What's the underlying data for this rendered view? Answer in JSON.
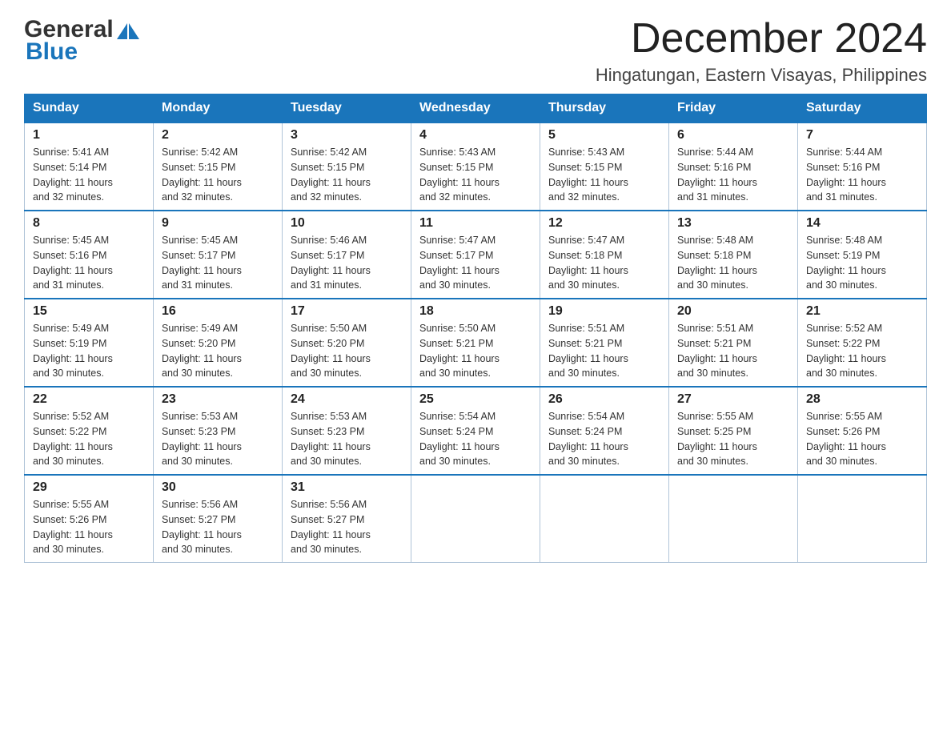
{
  "logo": {
    "general": "General",
    "blue": "Blue"
  },
  "title": "December 2024",
  "location": "Hingatungan, Eastern Visayas, Philippines",
  "days_of_week": [
    "Sunday",
    "Monday",
    "Tuesday",
    "Wednesday",
    "Thursday",
    "Friday",
    "Saturday"
  ],
  "weeks": [
    [
      {
        "day": "1",
        "sunrise": "5:41 AM",
        "sunset": "5:14 PM",
        "daylight": "11 hours and 32 minutes."
      },
      {
        "day": "2",
        "sunrise": "5:42 AM",
        "sunset": "5:15 PM",
        "daylight": "11 hours and 32 minutes."
      },
      {
        "day": "3",
        "sunrise": "5:42 AM",
        "sunset": "5:15 PM",
        "daylight": "11 hours and 32 minutes."
      },
      {
        "day": "4",
        "sunrise": "5:43 AM",
        "sunset": "5:15 PM",
        "daylight": "11 hours and 32 minutes."
      },
      {
        "day": "5",
        "sunrise": "5:43 AM",
        "sunset": "5:15 PM",
        "daylight": "11 hours and 32 minutes."
      },
      {
        "day": "6",
        "sunrise": "5:44 AM",
        "sunset": "5:16 PM",
        "daylight": "11 hours and 31 minutes."
      },
      {
        "day": "7",
        "sunrise": "5:44 AM",
        "sunset": "5:16 PM",
        "daylight": "11 hours and 31 minutes."
      }
    ],
    [
      {
        "day": "8",
        "sunrise": "5:45 AM",
        "sunset": "5:16 PM",
        "daylight": "11 hours and 31 minutes."
      },
      {
        "day": "9",
        "sunrise": "5:45 AM",
        "sunset": "5:17 PM",
        "daylight": "11 hours and 31 minutes."
      },
      {
        "day": "10",
        "sunrise": "5:46 AM",
        "sunset": "5:17 PM",
        "daylight": "11 hours and 31 minutes."
      },
      {
        "day": "11",
        "sunrise": "5:47 AM",
        "sunset": "5:17 PM",
        "daylight": "11 hours and 30 minutes."
      },
      {
        "day": "12",
        "sunrise": "5:47 AM",
        "sunset": "5:18 PM",
        "daylight": "11 hours and 30 minutes."
      },
      {
        "day": "13",
        "sunrise": "5:48 AM",
        "sunset": "5:18 PM",
        "daylight": "11 hours and 30 minutes."
      },
      {
        "day": "14",
        "sunrise": "5:48 AM",
        "sunset": "5:19 PM",
        "daylight": "11 hours and 30 minutes."
      }
    ],
    [
      {
        "day": "15",
        "sunrise": "5:49 AM",
        "sunset": "5:19 PM",
        "daylight": "11 hours and 30 minutes."
      },
      {
        "day": "16",
        "sunrise": "5:49 AM",
        "sunset": "5:20 PM",
        "daylight": "11 hours and 30 minutes."
      },
      {
        "day": "17",
        "sunrise": "5:50 AM",
        "sunset": "5:20 PM",
        "daylight": "11 hours and 30 minutes."
      },
      {
        "day": "18",
        "sunrise": "5:50 AM",
        "sunset": "5:21 PM",
        "daylight": "11 hours and 30 minutes."
      },
      {
        "day": "19",
        "sunrise": "5:51 AM",
        "sunset": "5:21 PM",
        "daylight": "11 hours and 30 minutes."
      },
      {
        "day": "20",
        "sunrise": "5:51 AM",
        "sunset": "5:21 PM",
        "daylight": "11 hours and 30 minutes."
      },
      {
        "day": "21",
        "sunrise": "5:52 AM",
        "sunset": "5:22 PM",
        "daylight": "11 hours and 30 minutes."
      }
    ],
    [
      {
        "day": "22",
        "sunrise": "5:52 AM",
        "sunset": "5:22 PM",
        "daylight": "11 hours and 30 minutes."
      },
      {
        "day": "23",
        "sunrise": "5:53 AM",
        "sunset": "5:23 PM",
        "daylight": "11 hours and 30 minutes."
      },
      {
        "day": "24",
        "sunrise": "5:53 AM",
        "sunset": "5:23 PM",
        "daylight": "11 hours and 30 minutes."
      },
      {
        "day": "25",
        "sunrise": "5:54 AM",
        "sunset": "5:24 PM",
        "daylight": "11 hours and 30 minutes."
      },
      {
        "day": "26",
        "sunrise": "5:54 AM",
        "sunset": "5:24 PM",
        "daylight": "11 hours and 30 minutes."
      },
      {
        "day": "27",
        "sunrise": "5:55 AM",
        "sunset": "5:25 PM",
        "daylight": "11 hours and 30 minutes."
      },
      {
        "day": "28",
        "sunrise": "5:55 AM",
        "sunset": "5:26 PM",
        "daylight": "11 hours and 30 minutes."
      }
    ],
    [
      {
        "day": "29",
        "sunrise": "5:55 AM",
        "sunset": "5:26 PM",
        "daylight": "11 hours and 30 minutes."
      },
      {
        "day": "30",
        "sunrise": "5:56 AM",
        "sunset": "5:27 PM",
        "daylight": "11 hours and 30 minutes."
      },
      {
        "day": "31",
        "sunrise": "5:56 AM",
        "sunset": "5:27 PM",
        "daylight": "11 hours and 30 minutes."
      },
      null,
      null,
      null,
      null
    ]
  ],
  "labels": {
    "sunrise": "Sunrise:",
    "sunset": "Sunset:",
    "daylight": "Daylight:"
  }
}
